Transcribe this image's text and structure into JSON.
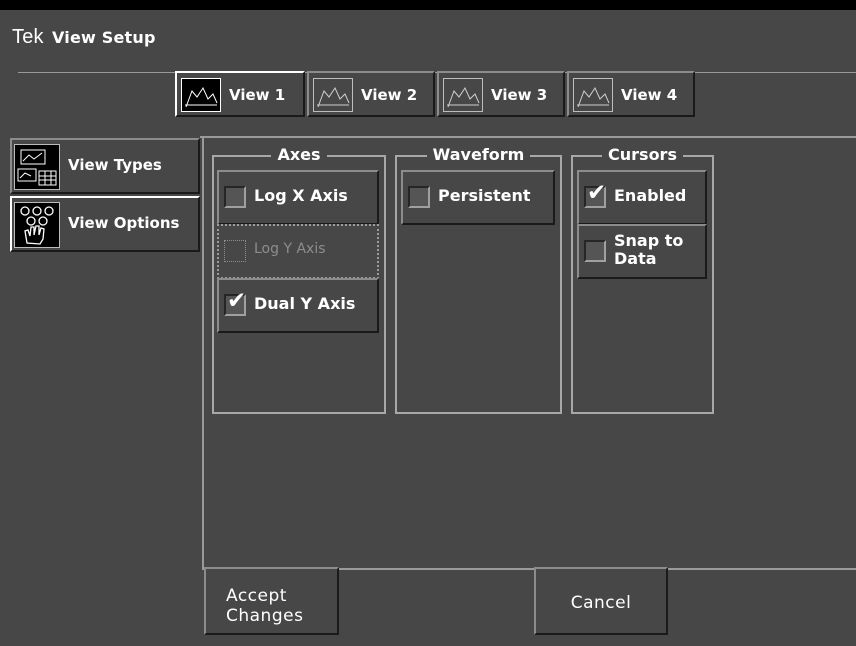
{
  "window": {
    "brand": "Tek",
    "title": "View Setup"
  },
  "view_tabs": [
    {
      "label": "View 1",
      "icon": "waveform-view-icon",
      "active": true
    },
    {
      "label": "View 2",
      "icon": "waveform-view-icon",
      "active": false
    },
    {
      "label": "View 3",
      "icon": "waveform-view-icon",
      "active": false
    },
    {
      "label": "View 4",
      "icon": "waveform-view-icon",
      "active": false
    }
  ],
  "side_nav": [
    {
      "label": "View Types",
      "icon": "view-types-icon"
    },
    {
      "label": "View Options",
      "icon": "view-options-icon"
    }
  ],
  "axes": {
    "title": "Axes",
    "log_x": {
      "label": "Log X Axis",
      "checked": false
    },
    "log_y": {
      "label": "Log Y Axis",
      "checked": false,
      "disabled": true
    },
    "dual_y": {
      "label": "Dual Y Axis",
      "checked": true
    }
  },
  "waveform": {
    "title": "Waveform",
    "persistent": {
      "label": "Persistent",
      "checked": false
    }
  },
  "cursors": {
    "title": "Cursors",
    "enabled": {
      "label": "Enabled",
      "checked": true
    },
    "snap": {
      "label": "Snap to Data",
      "checked": false
    }
  },
  "footer": {
    "accept_label": "Accept Changes",
    "cancel_label": "Cancel"
  },
  "checkmark_glyph": "✔"
}
